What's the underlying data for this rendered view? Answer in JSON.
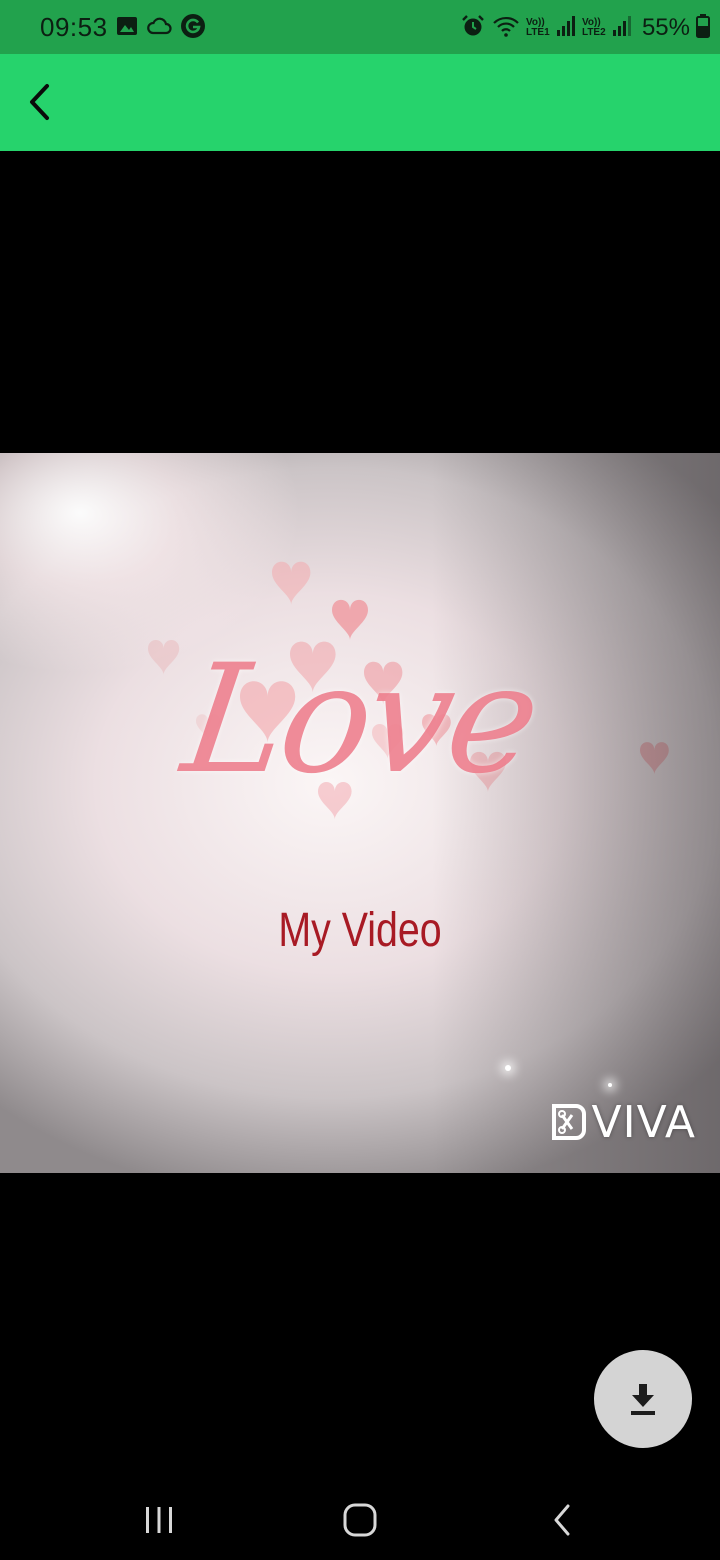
{
  "status_bar": {
    "time": "09:53",
    "battery_percent": "55%",
    "sim1_label_top": "Vo))",
    "sim1_label_bottom": "LTE1",
    "sim2_label_top": "Vo))",
    "sim2_label_bottom": "LTE2",
    "left_icons": [
      "image-icon",
      "cloud-icon",
      "g-app-icon"
    ],
    "right_icons": [
      "alarm-icon",
      "wifi-icon",
      "signal-icon",
      "battery-icon"
    ],
    "background_color": "#22a24d"
  },
  "app_bar": {
    "back_icon": "back-arrow-icon",
    "background_color": "#26d36c"
  },
  "video": {
    "title": "Love",
    "subtitle": "My Video",
    "watermark": "VIVA"
  },
  "download_button": {
    "icon": "download-icon"
  },
  "nav_bar": {
    "buttons": [
      "recent-apps-icon",
      "home-icon",
      "back-icon"
    ]
  }
}
